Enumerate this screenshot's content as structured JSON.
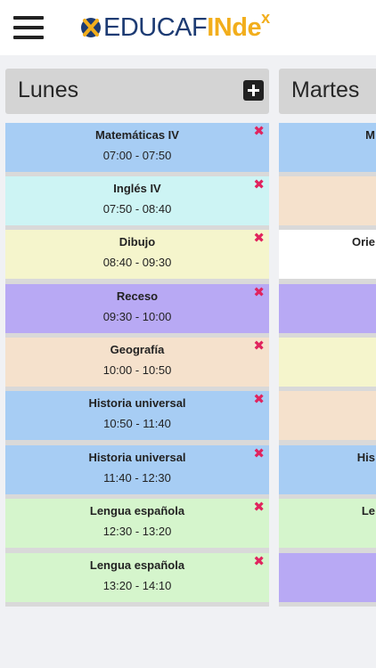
{
  "header": {
    "menu_icon": "hamburger-menu-icon",
    "logo": {
      "part1": "EDUCAF",
      "part2": "INde",
      "part3": "x",
      "colors": {
        "dark": "#1d3b73",
        "accent": "#f2ae1c"
      }
    }
  },
  "days": [
    {
      "name": "Lunes",
      "classes": [
        {
          "subject": "Matemáticas IV",
          "time": "07:00 - 07:50",
          "color": "#a7cdf4"
        },
        {
          "subject": "Inglés IV",
          "time": "07:50 - 08:40",
          "color": "#cdf4f4"
        },
        {
          "subject": "Dibujo",
          "time": "08:40 - 09:30",
          "color": "#f5f5cc"
        },
        {
          "subject": "Receso",
          "time": "09:30 - 10:00",
          "color": "#b8a9f4"
        },
        {
          "subject": "Geografía",
          "time": "10:00 - 10:50",
          "color": "#f5e1cc"
        },
        {
          "subject": "Historia universal",
          "time": "10:50 - 11:40",
          "color": "#a7cdf4"
        },
        {
          "subject": "Historia universal",
          "time": "11:40 - 12:30",
          "color": "#a7cdf4"
        },
        {
          "subject": "Lengua española",
          "time": "12:30 - 13:20",
          "color": "#d5f5cc"
        },
        {
          "subject": "Lengua española",
          "time": "13:20 - 14:10",
          "color": "#d5f5cc"
        }
      ]
    },
    {
      "name": "Martes",
      "classes": [
        {
          "subject": "M",
          "time": "",
          "color": "#a7cdf4"
        },
        {
          "subject": "",
          "time": "",
          "color": "#f5e1cc"
        },
        {
          "subject": "Orie",
          "time": "",
          "color": "#ffffff"
        },
        {
          "subject": "",
          "time": "",
          "color": "#b8a9f4"
        },
        {
          "subject": "",
          "time": "",
          "color": "#f5f5cc"
        },
        {
          "subject": "",
          "time": "",
          "color": "#f5e1cc"
        },
        {
          "subject": "His",
          "time": "",
          "color": "#a7cdf4"
        },
        {
          "subject": "Le",
          "time": "",
          "color": "#d5f5cc"
        },
        {
          "subject": "",
          "time": "",
          "color": "#b8a9f4"
        }
      ]
    }
  ],
  "icons": {
    "add": "plus-square-icon",
    "delete": "close-x-icon"
  }
}
